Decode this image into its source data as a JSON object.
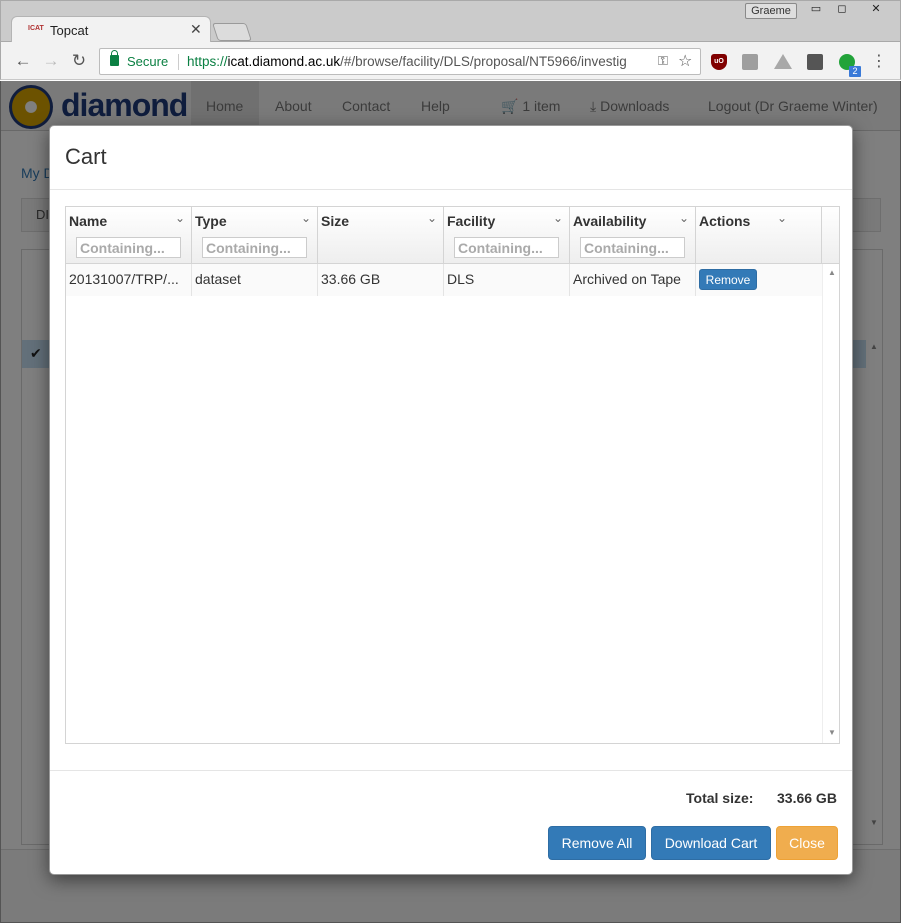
{
  "browser": {
    "tab_title": "Topcat",
    "tab_favicon_text": "ICAT",
    "profile_name": "Graeme",
    "secure_label": "Secure",
    "url_scheme": "https://",
    "url_host": "icat.diamond.ac.uk",
    "url_path": "/#/browse/facility/DLS/proposal/NT5966/investig",
    "extension_badge_count": "2"
  },
  "site": {
    "logo_text": "diamond",
    "nav": {
      "home": "Home",
      "about": "About",
      "contact": "Contact",
      "help": "Help",
      "cart": "1 item",
      "downloads": "Downloads",
      "logout": "Logout (Dr Graeme Winter)"
    },
    "breadcrumb_partial": "My D",
    "bar_partial": "DI"
  },
  "modal": {
    "title": "Cart",
    "columns": [
      {
        "title": "Name",
        "filter_placeholder": "Containing..."
      },
      {
        "title": "Type",
        "filter_placeholder": "Containing..."
      },
      {
        "title": "Size",
        "filter_placeholder": ""
      },
      {
        "title": "Facility",
        "filter_placeholder": "Containing..."
      },
      {
        "title": "Availability",
        "filter_placeholder": "Containing..."
      },
      {
        "title": "Actions",
        "filter_placeholder": ""
      }
    ],
    "rows": [
      {
        "name": "20131007/TRP/...",
        "type": "dataset",
        "size": "33.66 GB",
        "facility": "DLS",
        "availability": "Archived on Tape",
        "action_label": "Remove"
      }
    ],
    "total_label": "Total size:",
    "total_value": "33.66 GB",
    "buttons": {
      "remove_all": "Remove All",
      "download_cart": "Download Cart",
      "close": "Close"
    }
  }
}
